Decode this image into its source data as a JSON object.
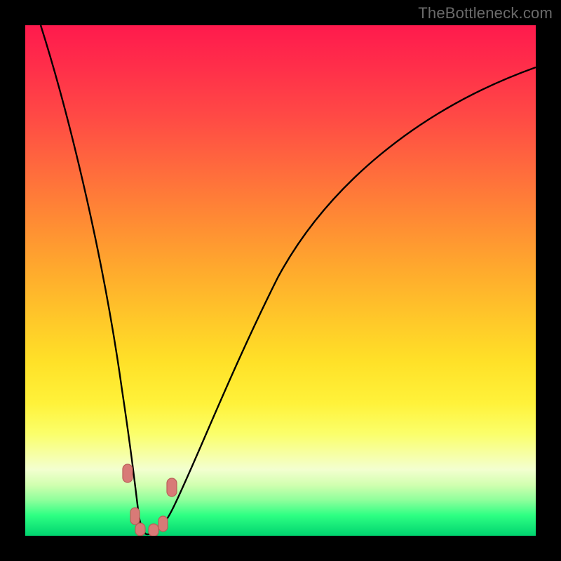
{
  "watermark": {
    "text": "TheBottleneck.com"
  },
  "colors": {
    "frame": "#000000",
    "curve_stroke": "#000000",
    "marker_fill": "#d87a77",
    "marker_stroke": "#b95a55"
  },
  "chart_data": {
    "type": "line",
    "title": "",
    "xlabel": "",
    "ylabel": "",
    "xlim": [
      0,
      100
    ],
    "ylim": [
      0,
      100
    ],
    "grid": false,
    "legend": false,
    "series": [
      {
        "name": "curve",
        "x": [
          3,
          6,
          9,
          12,
          14,
          16,
          18,
          19.5,
          20.5,
          21.3,
          21.8,
          22.3,
          23.5,
          25.5,
          27,
          29,
          32,
          36,
          41,
          47,
          54,
          62,
          72,
          84,
          100
        ],
        "y": [
          100,
          88,
          74,
          59,
          46,
          34,
          22,
          12,
          6,
          2.5,
          1,
          0.6,
          0.5,
          0.7,
          1.6,
          4,
          9,
          17,
          27,
          38,
          50,
          61,
          72,
          82,
          91
        ],
        "note": "Values read off the plot background; y=100 is top (red), y=0 is bottom (green). V-shaped curve with minimum near x≈22–24."
      }
    ],
    "annotations": [
      {
        "name": "marker",
        "x": 19.5,
        "y": 12
      },
      {
        "name": "marker",
        "x": 20.7,
        "y": 3.5
      },
      {
        "name": "marker",
        "x": 21.7,
        "y": 0.8
      },
      {
        "name": "marker",
        "x": 24.2,
        "y": 0.7
      },
      {
        "name": "marker",
        "x": 26.2,
        "y": 1.6
      },
      {
        "name": "marker",
        "x": 28.0,
        "y": 9
      }
    ]
  }
}
